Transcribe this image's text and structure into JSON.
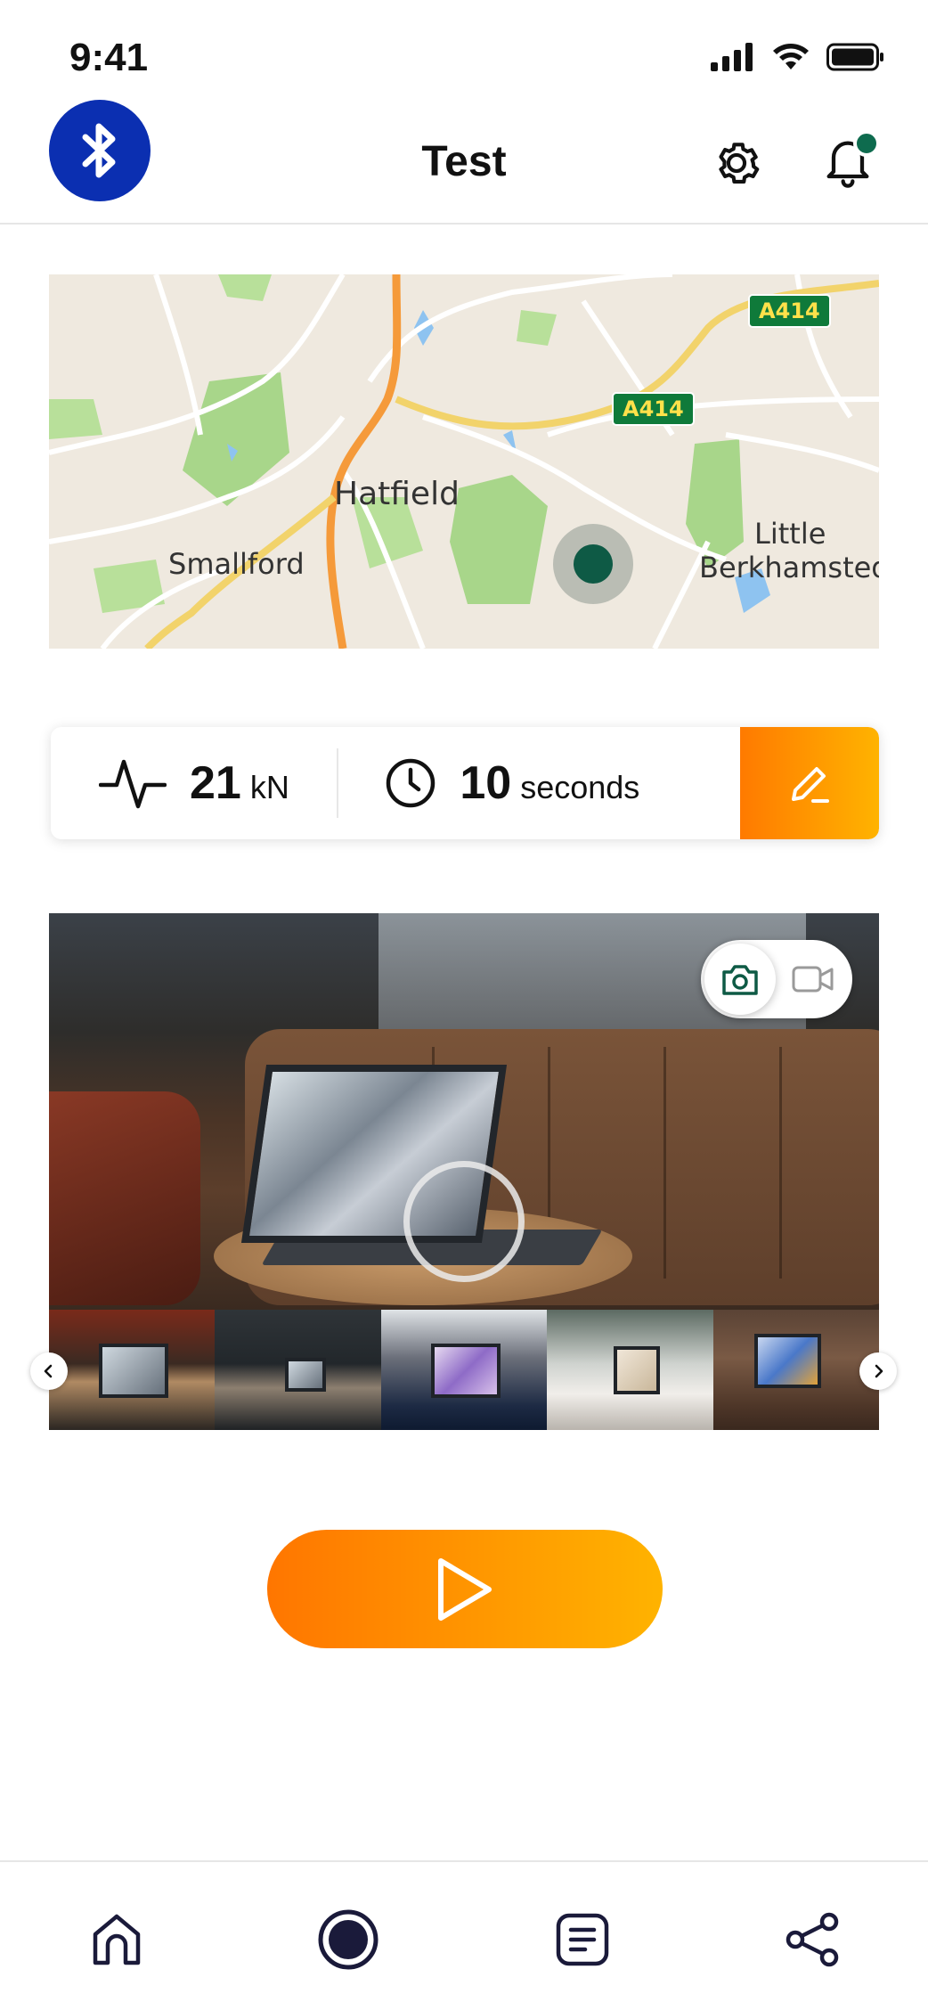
{
  "status_bar": {
    "time": "9:41",
    "icons": [
      "signal-icon",
      "wifi-icon",
      "battery-icon"
    ]
  },
  "header": {
    "title": "Test",
    "left_icon": "bluetooth-icon",
    "right_icons": [
      "gear-icon",
      "bell-icon"
    ],
    "notification_dot": true
  },
  "map": {
    "labels": {
      "hatfield": "Hatfield",
      "smallford": "Smallford",
      "little": "Little",
      "berkhamsted": "Berkhamsted"
    },
    "road_shields": {
      "top": "A414",
      "middle": "A414"
    }
  },
  "stats": {
    "force_value": "21",
    "force_unit": "kN",
    "time_value": "10",
    "time_unit": "seconds",
    "force_icon": "activity-icon",
    "time_icon": "clock-icon",
    "edit_icon": "pencil-icon"
  },
  "camera": {
    "modes": [
      "camera-icon",
      "video-icon"
    ],
    "selected_mode": "photo"
  },
  "thumbnails": {
    "count": 5,
    "prev_icon": "chevron-left-icon",
    "next_icon": "chevron-right-icon"
  },
  "start_button": {
    "icon": "play-icon"
  },
  "bottom_nav": {
    "items": [
      "home-icon",
      "record-icon",
      "document-icon",
      "share-icon"
    ]
  },
  "colors": {
    "accent_orange": "#ff7a00",
    "accent_yellow": "#ffb300",
    "bluetooth_blue": "#0b2fb1",
    "marker_green": "#0e5a45"
  }
}
